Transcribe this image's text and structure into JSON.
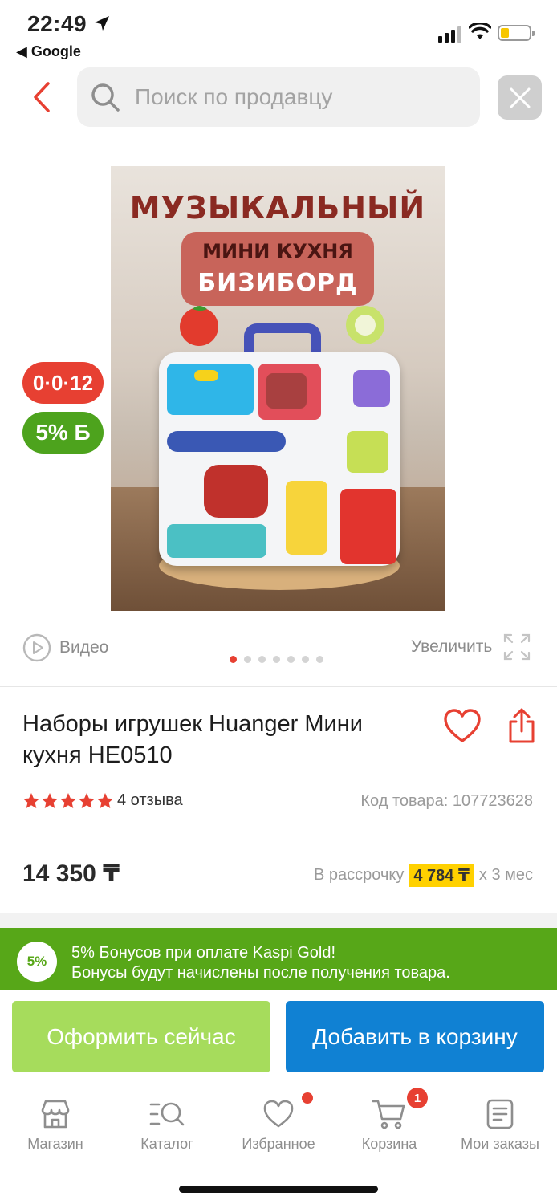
{
  "status_bar": {
    "time": "22:49",
    "back_app": "◀ Google"
  },
  "search": {
    "placeholder": "Поиск по продавцу"
  },
  "product_image": {
    "title": "МУЗЫКАЛЬНЫЙ",
    "subtitle_1": "МИНИ КУХНЯ",
    "subtitle_2": "БИЗИБОРД"
  },
  "badges": {
    "installment": "0·0·12",
    "bonus": "5% Б"
  },
  "gallery": {
    "video_label": "Видео",
    "zoom_label": "Увеличить",
    "dots_count": 7,
    "active_dot": 0
  },
  "product": {
    "title": "Наборы игрушек Huanger Мини кухня HE0510",
    "rating_stars": 5,
    "reviews": "4 отзыва",
    "sku": "Код товара: 107723628",
    "price": "14 350 ₸",
    "installment_prefix": "В рассрочку",
    "installment_amount": "4 784 ₸",
    "installment_suffix": "x 3 мес"
  },
  "bonus_banner": {
    "percent": "5%",
    "line1": "5% Бонусов при оплате Kaspi Gold!",
    "line2": "Бонусы будут начислены после получения товара."
  },
  "actions": {
    "buy_now": "Оформить сейчас",
    "add_to_cart": "Добавить в корзину"
  },
  "tabs": [
    {
      "label": "Магазин"
    },
    {
      "label": "Каталог"
    },
    {
      "label": "Избранное"
    },
    {
      "label": "Корзина",
      "badge": "1"
    },
    {
      "label": "Мои заказы"
    }
  ],
  "colors": {
    "accent_red": "#e74032",
    "bonus_green": "#57a718",
    "cart_blue": "#1081d3",
    "buy_green": "#a6dc5c",
    "highlight_yellow": "#ffd100"
  }
}
